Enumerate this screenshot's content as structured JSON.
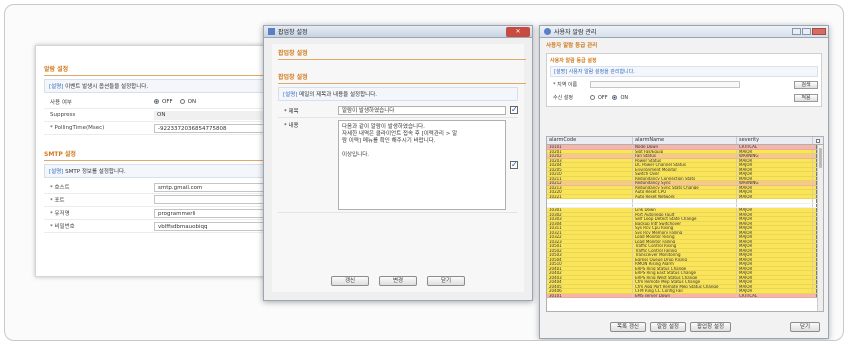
{
  "colors": {
    "accent_orange": "#d17a1c",
    "critical": "#f7b5a9",
    "major": "#f9e45a",
    "warning": "#f5c88d",
    "title_blue": "#3a6bc4"
  },
  "alarm_settings": {
    "title": "알람 설정",
    "desc_tag": "[설명]",
    "desc": "이벤트 발생시 옵션들을 설정합니다.",
    "rows": [
      {
        "label": "사용 여부",
        "off": "OFF",
        "on": "ON"
      },
      {
        "label": "Suppress",
        "value": "ON"
      },
      {
        "label": "* PollingTime(Msec)",
        "value": "-9223372036854775808"
      }
    ]
  },
  "smtp_settings": {
    "title": "SMTP 설정",
    "desc_tag": "[설명]",
    "desc": "SMTP 정보를 설정합니다.",
    "rows": [
      {
        "label": "* 호스트",
        "value": "smtp.gmail.com"
      },
      {
        "label": "* 포트",
        "value": ""
      },
      {
        "label": "* 유저명",
        "value": "programmerli"
      },
      {
        "label": "* 비밀번호",
        "value": "vblffsdbmauobiqq"
      }
    ]
  },
  "popup": {
    "window_title": "팝업창 설정",
    "header": "팝업창 설정",
    "sub_title": "팝업창 설정",
    "desc_tag": "[설명]",
    "desc": "메일의 제목과 내용을 설정합니다.",
    "subject_label": "* 제목",
    "subject_value": "알람이 발생하였습니다",
    "body_label": "* 내용",
    "body_lines": [
      "다음과 같이 알람이 발생하였습니다.",
      "자세한 내역은 클라이언트 접속 후 [이력관리 > 알",
      "람 이력] 메뉴를 확인 해주시기 바랍니다.",
      "",
      "이상입니다."
    ],
    "buttons": {
      "refresh": "갱신",
      "change": "변경",
      "close": "닫기"
    }
  },
  "grade": {
    "window_title": "사용자 알람 관리",
    "header": "사용자 알람 등급 관리",
    "group_title": "사용자 알람 등급 설정",
    "group_desc": "[설명] 사용자 알람 설정을 관리합니다.",
    "search_label": "* 지역 이름",
    "search_btn": "검색",
    "use_label": "수신 설정",
    "off": "OFF",
    "on": "ON",
    "apply_btn": "적용",
    "columns": {
      "code": "alarmCode",
      "name": "alarmName",
      "severity": "severity"
    },
    "rows": [
      {
        "code": "10101",
        "name": "Node Down",
        "sev": "CRITICAL",
        "cls": "crit",
        "chk": false
      },
      {
        "code": "10201",
        "name": "Slot Fail/Equip",
        "sev": "MAJOR",
        "cls": "major",
        "chk": false
      },
      {
        "code": "10202",
        "name": "Fan Status",
        "sev": "WARNING",
        "cls": "warn",
        "chk": false
      },
      {
        "code": "10203",
        "name": "Power Status",
        "sev": "MAJOR",
        "cls": "major",
        "chk": false
      },
      {
        "code": "10204",
        "name": "DC Power Channel Status",
        "sev": "MAJOR",
        "cls": "major",
        "chk": false
      },
      {
        "code": "10205",
        "name": "Environment Monitor",
        "sev": "MAJOR",
        "cls": "major",
        "chk": false
      },
      {
        "code": "10210",
        "name": "Switch Over",
        "sev": "MAJOR",
        "cls": "major",
        "chk": false
      },
      {
        "code": "10211",
        "name": "Redundancy Connection Stats",
        "sev": "MAJOR",
        "cls": "major",
        "chk": false
      },
      {
        "code": "10212",
        "name": "Redundancy Sync",
        "sev": "WARNING",
        "cls": "warn",
        "chk": false
      },
      {
        "code": "10213",
        "name": "Redundancy Sync Stats Change",
        "sev": "MAJOR",
        "cls": "major",
        "chk": false
      },
      {
        "code": "10220",
        "name": "Auto Reset CPU",
        "sev": "MAJOR",
        "cls": "major",
        "chk": false
      },
      {
        "code": "10221",
        "name": "Auto Reset Network",
        "sev": "MAJOR",
        "cls": "major",
        "chk": false
      },
      {
        "code": "",
        "name": "",
        "sev": "",
        "cls": "blank",
        "chk": false
      },
      {
        "code": "",
        "name": "",
        "sev": "",
        "cls": "blank",
        "chk": true
      },
      {
        "code": "10301",
        "name": "Link Down",
        "sev": "MAJOR",
        "cls": "major",
        "chk": false
      },
      {
        "code": "10302",
        "name": "Port Autoneqo Fault",
        "sev": "MAJOR",
        "cls": "major",
        "chk": true
      },
      {
        "code": "10303",
        "name": "Self Loop Detect State Change",
        "sev": "MAJOR",
        "cls": "major",
        "chk": false
      },
      {
        "code": "10304",
        "name": "Backup Intf Switchover",
        "sev": "MAJOR",
        "cls": "major",
        "chk": false
      },
      {
        "code": "10311",
        "name": "Sys Rcv Cpu Rising",
        "sev": "MAJOR",
        "cls": "major",
        "chk": true
      },
      {
        "code": "10321",
        "name": "Sys Rcv Memory Falling",
        "sev": "MAJOR",
        "cls": "major",
        "chk": false
      },
      {
        "code": "10322",
        "name": "Load Monitor Rising",
        "sev": "MAJOR",
        "cls": "major",
        "chk": false
      },
      {
        "code": "10323",
        "name": "Load Monitor Falling",
        "sev": "MAJOR",
        "cls": "major",
        "chk": false
      },
      {
        "code": "10501",
        "name": "Traffic Control Rising",
        "sev": "MAJOR",
        "cls": "major",
        "chk": false
      },
      {
        "code": "10502",
        "name": "Traffic Control Falling",
        "sev": "MAJOR",
        "cls": "major",
        "chk": false
      },
      {
        "code": "10503",
        "name": "Transceiver Monitoring",
        "sev": "MAJOR",
        "cls": "major",
        "chk": false
      },
      {
        "code": "10504",
        "name": "Egress Queue Drop Rising",
        "sev": "MAJOR",
        "cls": "major",
        "chk": false
      },
      {
        "code": "10510",
        "name": "RMON Rising Alarm",
        "sev": "MAJOR",
        "cls": "major",
        "chk": false
      },
      {
        "code": "20401",
        "name": "ERPS Ring Status Change",
        "sev": "MAJOR",
        "cls": "major",
        "chk": false
      },
      {
        "code": "20402",
        "name": "ERPS Ring East Status Change",
        "sev": "MAJOR",
        "cls": "major",
        "chk": false
      },
      {
        "code": "20403",
        "name": "ERPS Ring West Status Change",
        "sev": "MAJOR",
        "cls": "major",
        "chk": true
      },
      {
        "code": "20404",
        "name": "Cfm Remote Mep Status Change",
        "sev": "MAJOR",
        "cls": "major",
        "chk": false
      },
      {
        "code": "20405",
        "name": "Cfm Agg Port Remote Mep Status Change",
        "sev": "MAJOR",
        "cls": "major",
        "chk": false
      },
      {
        "code": "20406",
        "name": "CFM Ring CC Config Fail",
        "sev": "MAJOR",
        "cls": "major",
        "chk": false
      },
      {
        "code": "30101",
        "name": "EMS server Down",
        "sev": "CRITICAL",
        "cls": "crit",
        "chk": false
      }
    ],
    "buttons": {
      "refresh": "목록 갱신",
      "alarm": "알람 설정",
      "popup": "팝업창 설정",
      "close": "닫기"
    }
  }
}
